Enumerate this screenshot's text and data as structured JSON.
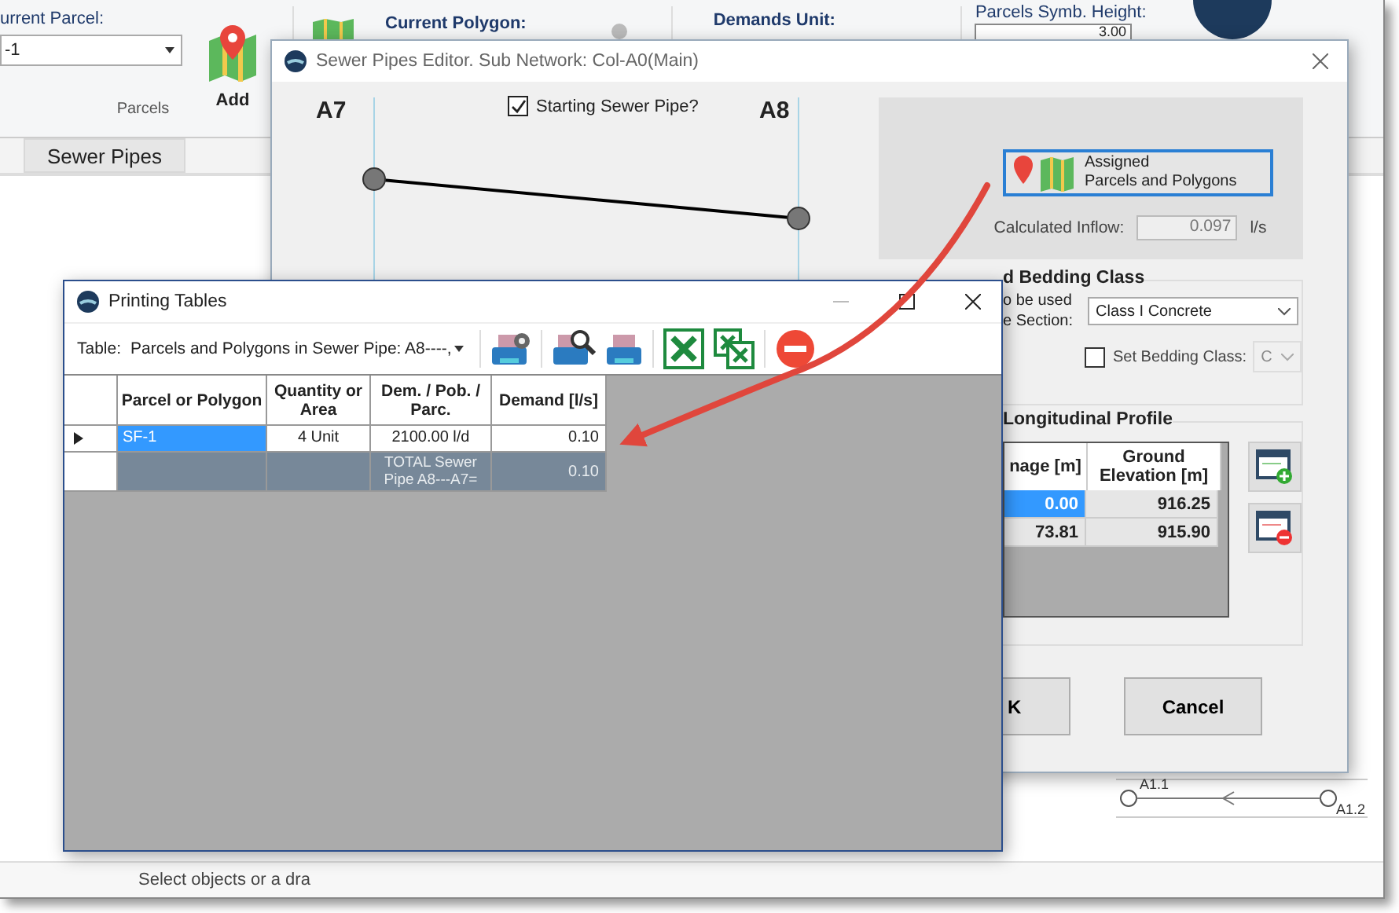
{
  "app": {
    "ribbon": {
      "current_parcel_label": "urrent Parcel:",
      "current_parcel_value": "-1",
      "add_label": "Add",
      "group_label": "Parcels",
      "current_polygon_label": "Current Polygon:",
      "demands_unit_label": "Demands Unit:",
      "symb_height_label": "Parcels Symb. Height:",
      "symb_height_value": "3.00"
    },
    "tabs": [
      {
        "label": "Sewer Pipes",
        "selected": true
      }
    ],
    "canvas_labels": [
      "A1.1",
      "A1.2"
    ],
    "status_bar": {
      "text": "Select objects or a dra"
    }
  },
  "editor": {
    "title": "Sewer Pipes Editor. Sub Network: Col-A0(Main)",
    "start_node": "A7",
    "end_node": "A8",
    "starting_pipe": {
      "label": "Starting Sewer Pipe?",
      "checked": true
    },
    "assigned_button": {
      "line_1": "Assigned",
      "line_2": "Parcels and Polygons"
    },
    "inflow": {
      "label": "Calculated Inflow:",
      "value": "0.097",
      "unit": "l/s"
    },
    "bedding": {
      "title": "d Bedding Class",
      "section_label_1": "o be used",
      "section_label_2": "e Section:",
      "section_value": "Class I Concrete",
      "set_class": {
        "label": "Set Bedding Class:",
        "checked": false
      },
      "class_value": "C",
      "class_disabled": true
    },
    "profile": {
      "title": "Longitudinal Profile",
      "columns": [
        "nage [m]",
        "Ground Elevation [m]"
      ],
      "rows": [
        {
          "cells": [
            "0.00",
            "916.25"
          ],
          "selected": true
        },
        {
          "cells": [
            "73.81",
            "915.90"
          ],
          "selected": false
        }
      ]
    },
    "buttons": [
      "K",
      "Cancel"
    ]
  },
  "printing_tables": {
    "title": "Printing Tables",
    "table_label": "Table:",
    "table_value": "Parcels and Polygons in Sewer Pipe: A8----,",
    "columns": [
      "Parcel or Polygon",
      "Quantity or Area",
      "Dem. / Pob. / Parc.",
      "Demand [l/s]"
    ],
    "rows": [
      {
        "kind": "data",
        "current": true,
        "cells": [
          "SF-1",
          "4 Unit",
          "2100.00 l/d",
          "0.10"
        ]
      },
      {
        "kind": "total",
        "current": false,
        "cells": [
          "",
          "",
          "TOTAL Sewer Pipe A8---A7=",
          "0.10"
        ]
      }
    ]
  }
}
